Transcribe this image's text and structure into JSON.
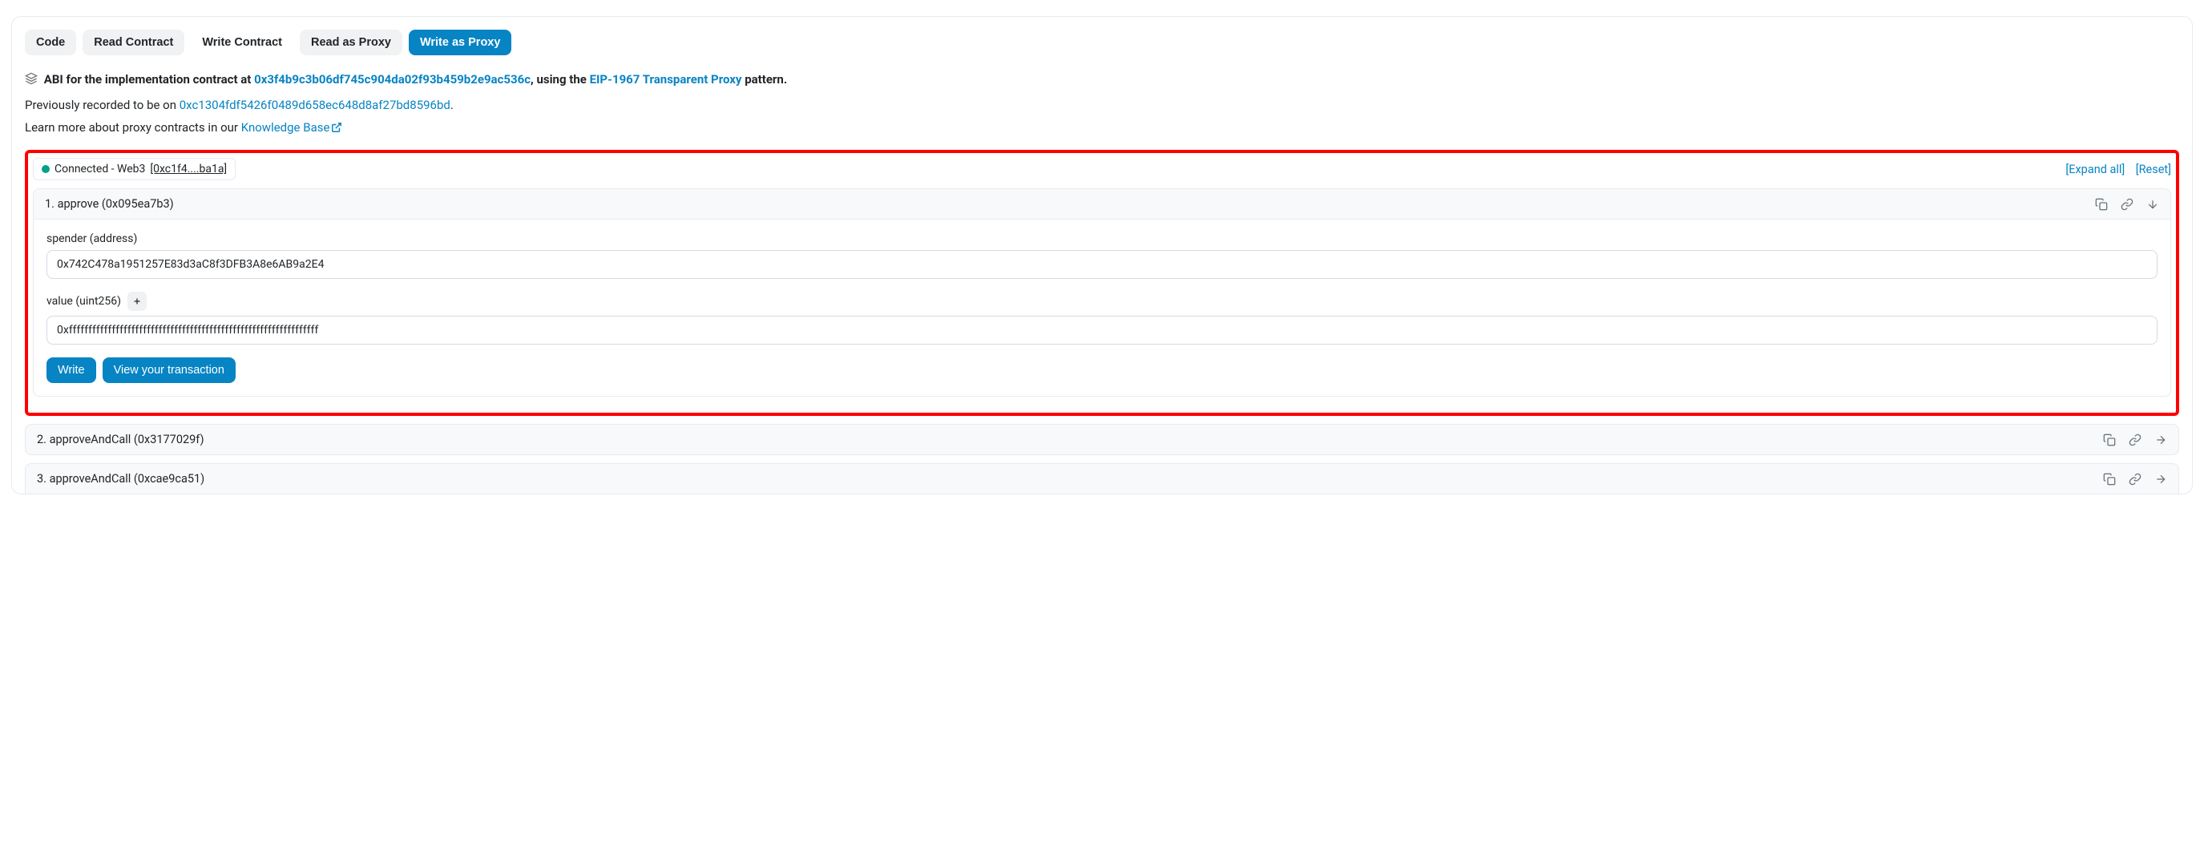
{
  "tabs": [
    {
      "label": "Code",
      "active": false,
      "plain": false
    },
    {
      "label": "Read Contract",
      "active": false,
      "plain": false
    },
    {
      "label": "Write Contract",
      "active": false,
      "plain": true
    },
    {
      "label": "Read as Proxy",
      "active": false,
      "plain": false
    },
    {
      "label": "Write as Proxy",
      "active": true,
      "plain": false
    }
  ],
  "abi": {
    "prefix": " ABI for the implementation contract at ",
    "impl_addr": "0x3f4b9c3b06df745c904da02f93b459b2e9ac536c",
    "middle": ", using the ",
    "proxy_link": "EIP-1967 Transparent Proxy",
    "suffix": " pattern."
  },
  "prev": {
    "prefix": "Previously recorded to be on ",
    "addr": "0xc1304fdf5426f0489d658ec648d8af27bd8596bd",
    "suffix": "."
  },
  "kb": {
    "prefix": "Learn more about proxy contracts in our ",
    "link": "Knowledge Base"
  },
  "connection": {
    "status": "Connected - Web3",
    "short_addr": "[0xc1f4....ba1a]",
    "expand": "[Expand all]",
    "reset": "[Reset]"
  },
  "functions": [
    {
      "title": "1. approve (0x095ea7b3)",
      "expanded": true,
      "fields": [
        {
          "label": "spender (address)",
          "value": "0x742C478a1951257E83d3aC8f3DFB3A8e6AB9a2E4",
          "has_plus": false
        },
        {
          "label": "value (uint256)",
          "value": "0xffffffffffffffffffffffffffffffffffffffffffffffffffffffffffffffff",
          "has_plus": true
        }
      ],
      "write_label": "Write",
      "view_tx_label": "View your transaction"
    },
    {
      "title": "2. approveAndCall (0x3177029f)",
      "expanded": false
    },
    {
      "title": "3. approveAndCall (0xcae9ca51)",
      "expanded": false
    }
  ]
}
